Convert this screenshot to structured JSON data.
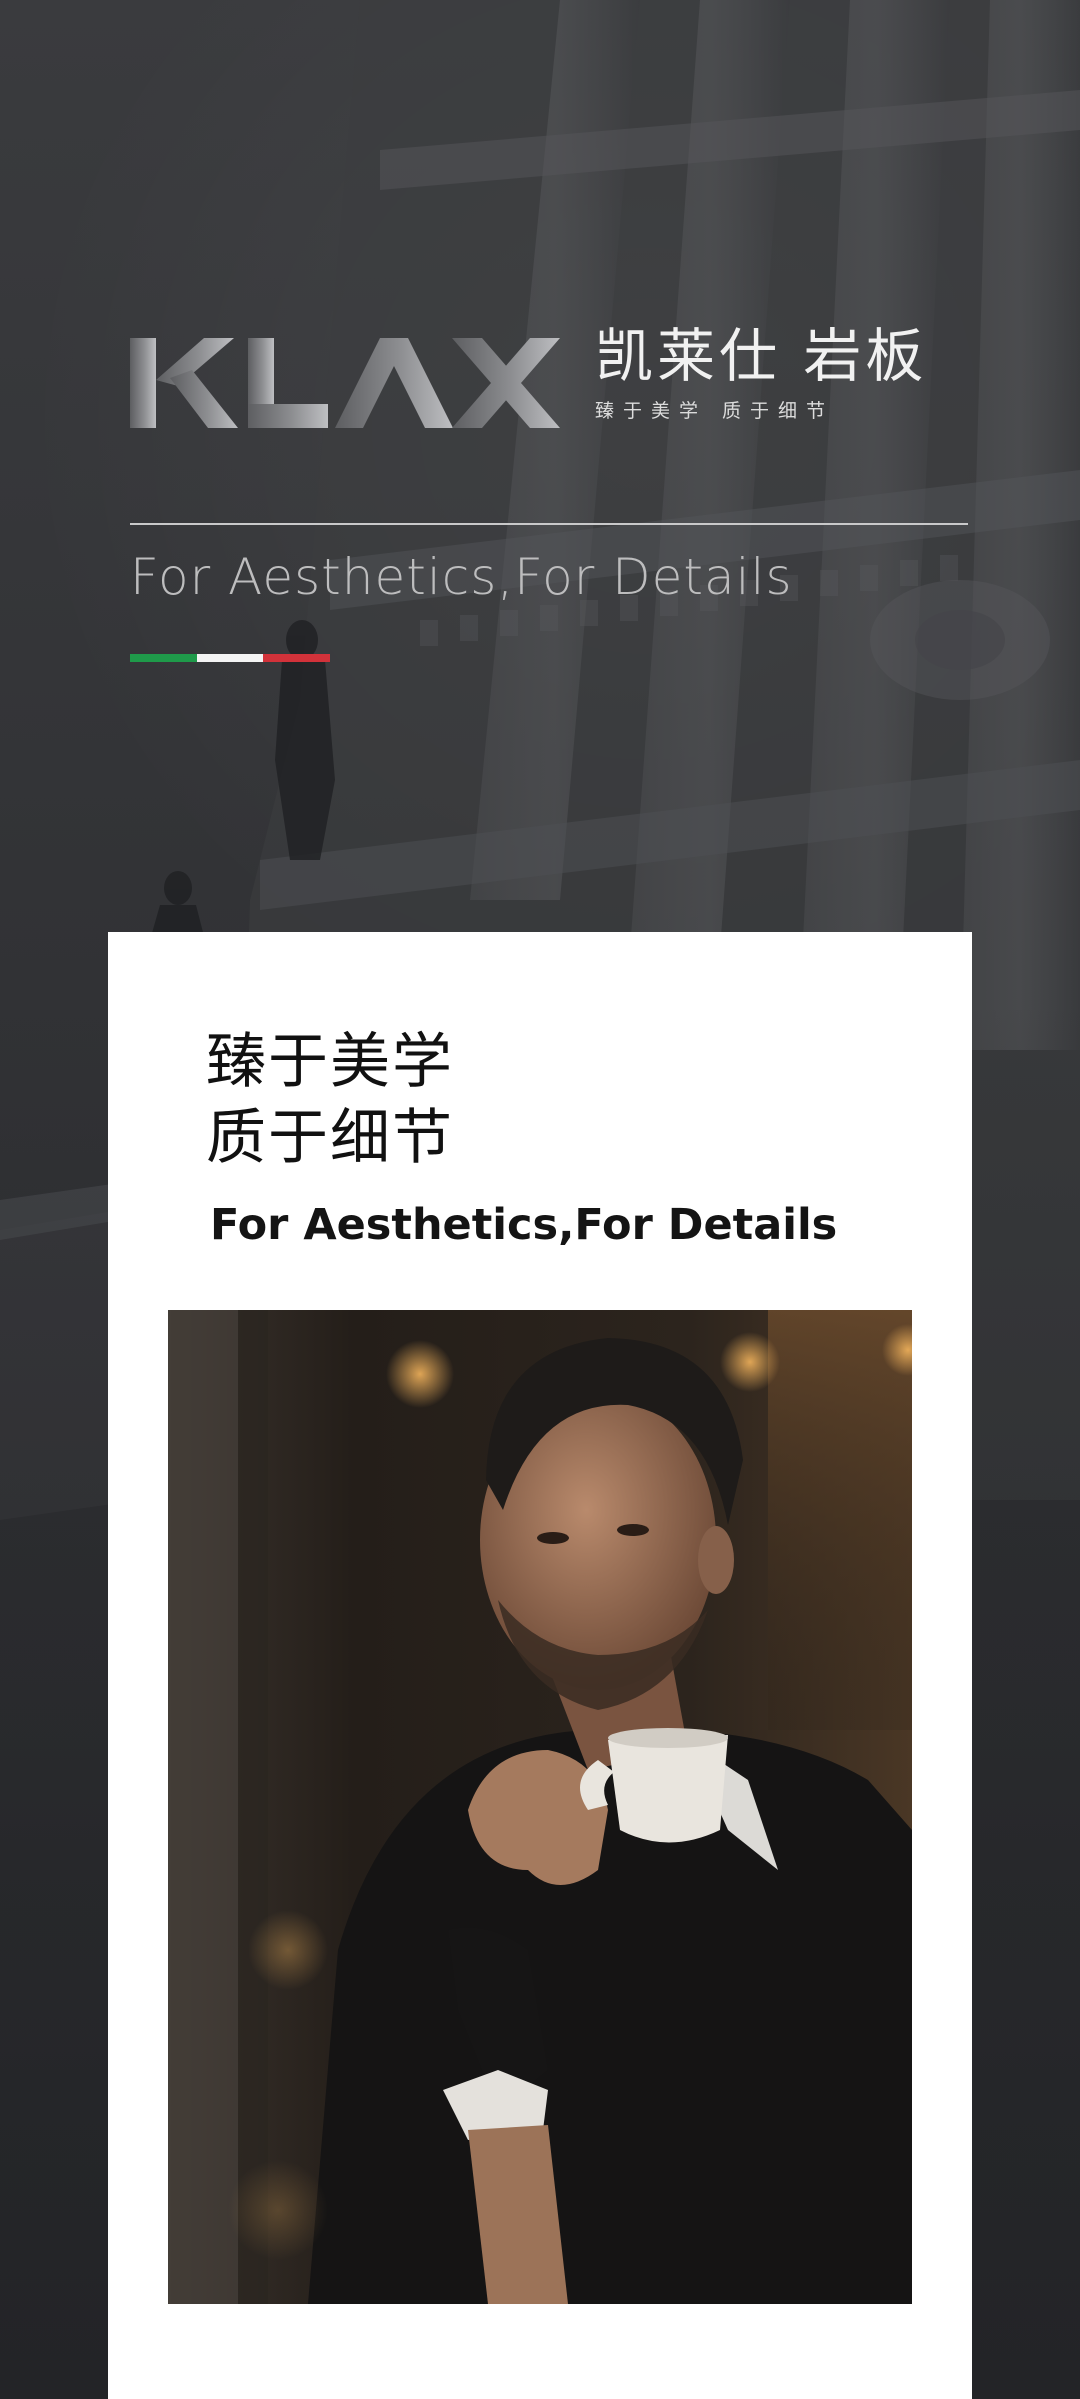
{
  "brand": {
    "logo_text": "KLAX",
    "name_cn": "凯莱仕 岩板",
    "slogan_cn": "臻于美学 质于细节"
  },
  "hero": {
    "tagline": "For Aesthetics,For Details"
  },
  "colors": {
    "flag_green": "#1f9a4a",
    "flag_white": "#f4f4f4",
    "flag_red": "#d2323a",
    "background": "#2f3033",
    "card": "#ffffff"
  },
  "card": {
    "title_cn_line1": "臻于美学",
    "title_cn_line2": "质于细节",
    "title_en": "For Aesthetics,For Details"
  },
  "icons": {
    "background": "neoclassical-building-illustration",
    "photo": "man-holding-coffee-cup-photo"
  }
}
